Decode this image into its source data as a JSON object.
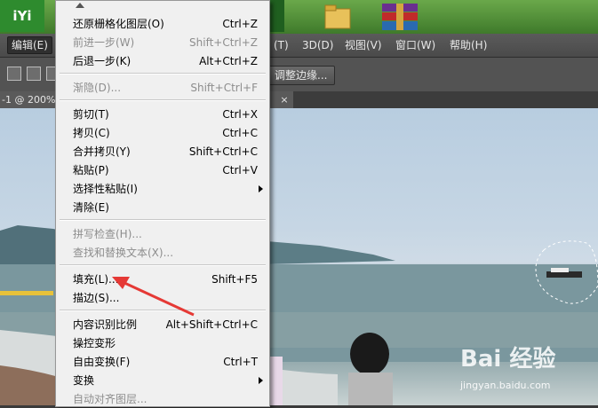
{
  "desktop": {
    "iqiyi_logo": "iYi"
  },
  "menubar": {
    "edit": "编辑(E)",
    "items_right": [
      "(T)",
      "3D(D)",
      "视图(V)",
      "窗口(W)",
      "帮助(H)"
    ]
  },
  "options_bar": {
    "refine_edge_label": "调整边缘..."
  },
  "document": {
    "tab_title": "-1 @ 200%",
    "close_glyph": "×"
  },
  "menu": {
    "items": [
      {
        "label": "还原栅格化图层(O)",
        "shortcut": "Ctrl+Z",
        "enabled": true
      },
      {
        "label": "前进一步(W)",
        "shortcut": "Shift+Ctrl+Z",
        "enabled": false
      },
      {
        "label": "后退一步(K)",
        "shortcut": "Alt+Ctrl+Z",
        "enabled": true
      },
      {
        "label": "渐隐(D)...",
        "shortcut": "Shift+Ctrl+F",
        "enabled": false
      },
      {
        "label": "剪切(T)",
        "shortcut": "Ctrl+X",
        "enabled": true
      },
      {
        "label": "拷贝(C)",
        "shortcut": "Ctrl+C",
        "enabled": true
      },
      {
        "label": "合并拷贝(Y)",
        "shortcut": "Shift+Ctrl+C",
        "enabled": true
      },
      {
        "label": "粘贴(P)",
        "shortcut": "Ctrl+V",
        "enabled": true
      },
      {
        "label": "选择性粘贴(I)",
        "shortcut": "",
        "enabled": true,
        "submenu": true
      },
      {
        "label": "清除(E)",
        "shortcut": "",
        "enabled": true
      },
      {
        "label": "拼写检查(H)...",
        "shortcut": "",
        "enabled": false
      },
      {
        "label": "查找和替换文本(X)...",
        "shortcut": "",
        "enabled": false
      },
      {
        "label": "填充(L)...",
        "shortcut": "Shift+F5",
        "enabled": true
      },
      {
        "label": "描边(S)...",
        "shortcut": "",
        "enabled": true
      },
      {
        "label": "内容识别比例",
        "shortcut": "Alt+Shift+Ctrl+C",
        "enabled": true
      },
      {
        "label": "操控变形",
        "shortcut": "",
        "enabled": true
      },
      {
        "label": "自由变换(F)",
        "shortcut": "Ctrl+T",
        "enabled": true
      },
      {
        "label": "变换",
        "shortcut": "",
        "enabled": true,
        "submenu": true
      },
      {
        "label": "自动对齐图层...",
        "shortcut": "",
        "enabled": false
      }
    ]
  },
  "watermark": {
    "main": "Bai 经验",
    "url": "jingyan.baidu.com"
  },
  "colors": {
    "annotation_arrow": "#e53935",
    "menu_bg": "#f0f0f0",
    "menubar_bg": "#4f4f4f"
  }
}
